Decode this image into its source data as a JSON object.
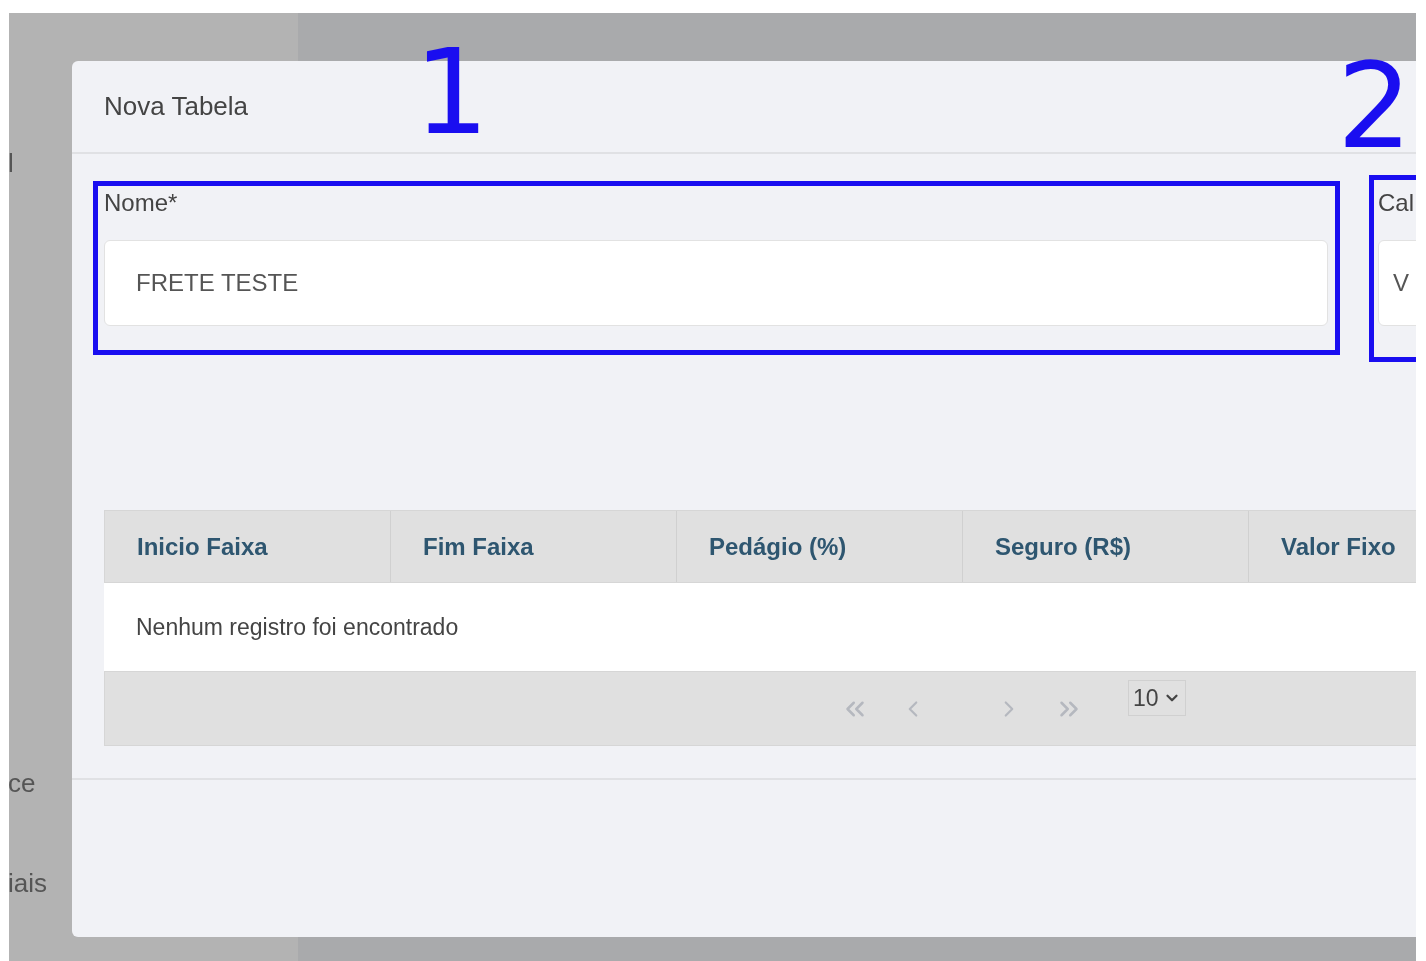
{
  "sidebar": {
    "items": [
      {
        "label": "l"
      },
      {
        "label": "ce"
      },
      {
        "label": "iais"
      }
    ]
  },
  "modal": {
    "title": "Nova Tabela",
    "fields": [
      {
        "label": "Nome*",
        "value": "FRETE TESTE"
      },
      {
        "label": "Cal",
        "value": "V"
      }
    ],
    "table": {
      "columns": [
        "Inicio Faixa",
        "Fim Faixa",
        "Pedágio (%)",
        "Seguro (R$)",
        "Valor Fixo"
      ],
      "empty_message": "Nenhum registro foi encontrado",
      "page_size": "10"
    }
  },
  "annotations": [
    {
      "number": "1"
    },
    {
      "number": "2"
    }
  ]
}
